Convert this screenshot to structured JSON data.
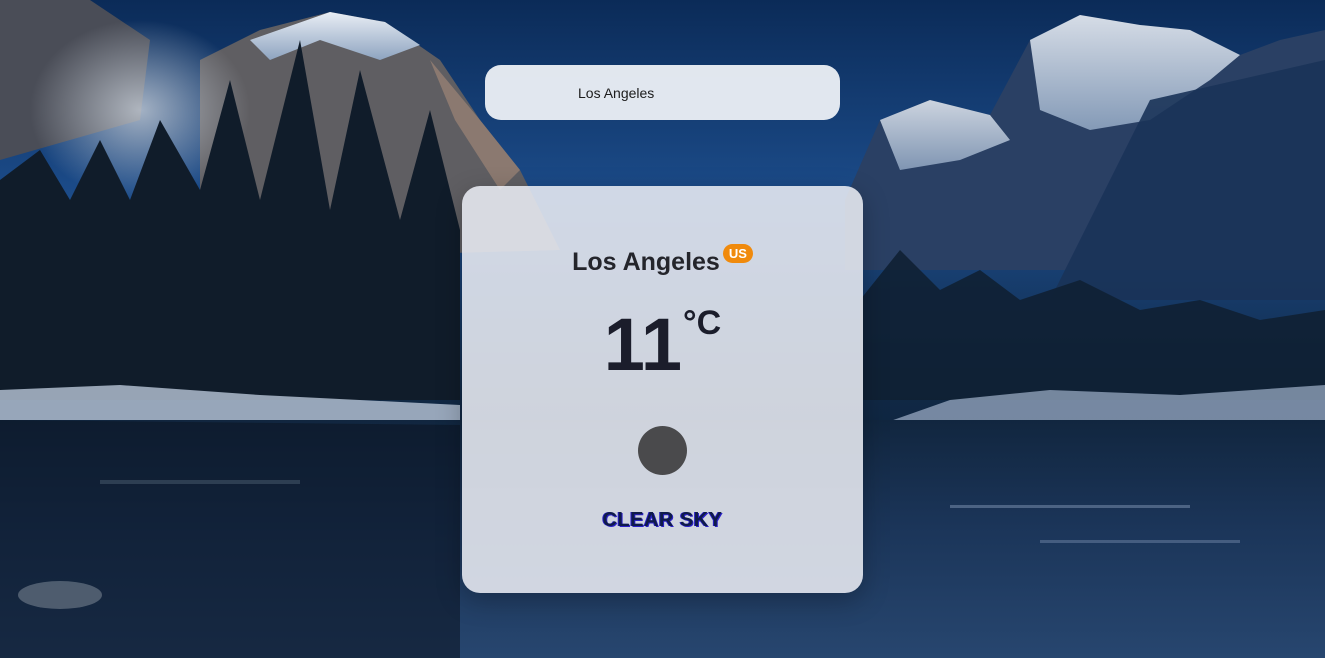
{
  "search": {
    "value": "Los Angeles",
    "placeholder": ""
  },
  "weather": {
    "city": "Los Angeles",
    "country": "US",
    "temperature": "11",
    "unit": "°C",
    "condition": "CLEAR SKY",
    "icon": "weather-status-icon"
  },
  "colors": {
    "badge": "#f08a0c",
    "condition_text": "#0f1b4a",
    "icon": "#4a4a4c"
  }
}
